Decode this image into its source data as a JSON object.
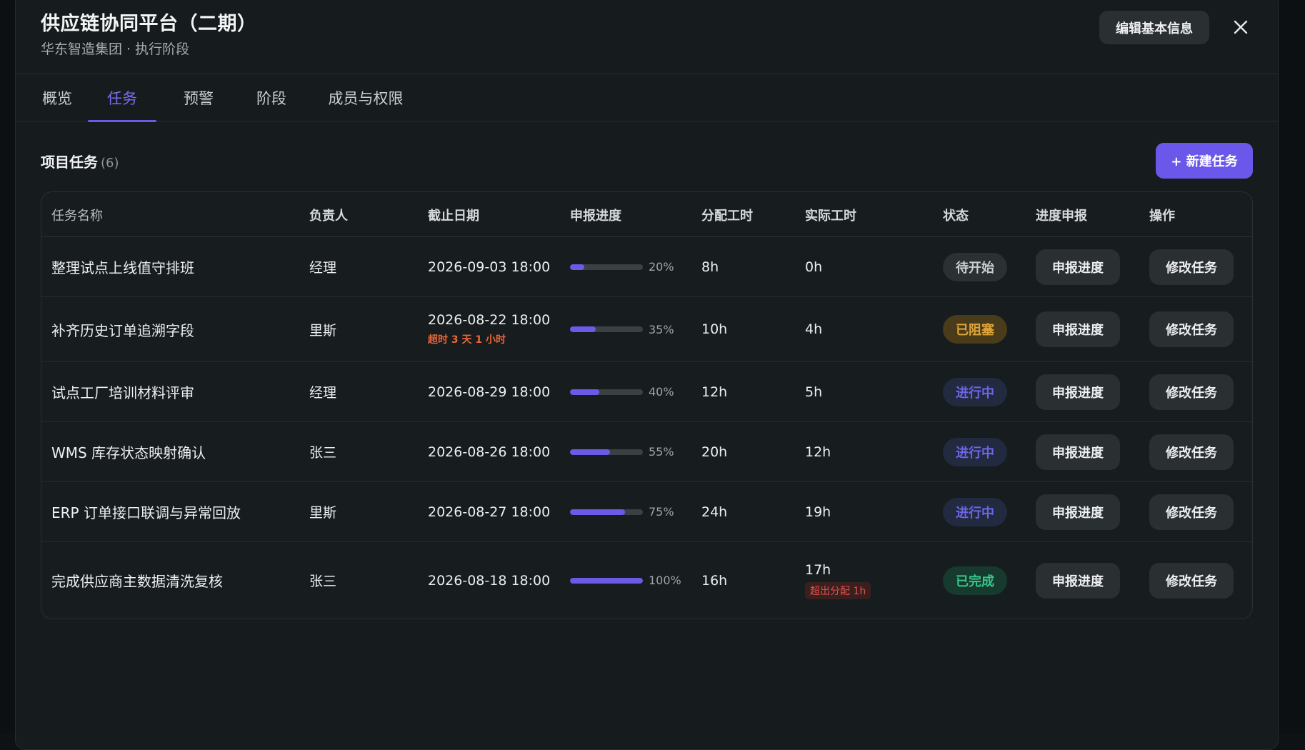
{
  "header": {
    "title": "供应链协同平台（二期）",
    "subtitle": "华东智造集团 · 执行阶段",
    "edit_label": "编辑基本信息",
    "close_icon": "close-icon"
  },
  "tabs": [
    {
      "label": "概览",
      "active": false
    },
    {
      "label": "任务",
      "active": true
    },
    {
      "label": "预警",
      "active": false
    },
    {
      "label": "阶段",
      "active": false
    },
    {
      "label": "成员与权限",
      "active": false
    }
  ],
  "section": {
    "title": "项目任务",
    "count": "(6)",
    "new_label": "+ 新建任务"
  },
  "table": {
    "columns": [
      "任务名称",
      "负责人",
      "截止日期",
      "申报进度",
      "分配工时",
      "实际工时",
      "状态",
      "进度申报",
      "操作"
    ],
    "rows": [
      {
        "name": "整理试点上线值守排班",
        "owner": "经理",
        "deadline": "2026-09-03 18:00",
        "deadline_note": "",
        "progress": 20,
        "progress_label": "20%",
        "allocated": "8h",
        "actual": "0h",
        "actual_note": "",
        "status": "待开始",
        "status_type": "pending",
        "report": "申报进度",
        "edit": "修改任务"
      },
      {
        "name": "补齐历史订单追溯字段",
        "owner": "里斯",
        "deadline": "2026-08-22 18:00",
        "deadline_note": "超时 3 天 1 小时",
        "progress": 35,
        "progress_label": "35%",
        "allocated": "10h",
        "actual": "4h",
        "actual_note": "",
        "status": "已阻塞",
        "status_type": "blocked",
        "report": "申报进度",
        "edit": "修改任务"
      },
      {
        "name": "试点工厂培训材料评审",
        "owner": "经理",
        "deadline": "2026-08-29 18:00",
        "deadline_note": "",
        "progress": 40,
        "progress_label": "40%",
        "allocated": "12h",
        "actual": "5h",
        "actual_note": "",
        "status": "进行中",
        "status_type": "running",
        "report": "申报进度",
        "edit": "修改任务"
      },
      {
        "name": "WMS 库存状态映射确认",
        "owner": "张三",
        "deadline": "2026-08-26 18:00",
        "deadline_note": "",
        "progress": 55,
        "progress_label": "55%",
        "allocated": "20h",
        "actual": "12h",
        "actual_note": "",
        "status": "进行中",
        "status_type": "running",
        "report": "申报进度",
        "edit": "修改任务"
      },
      {
        "name": "ERP 订单接口联调与异常回放",
        "owner": "里斯",
        "deadline": "2026-08-27 18:00",
        "deadline_note": "",
        "progress": 75,
        "progress_label": "75%",
        "allocated": "24h",
        "actual": "19h",
        "actual_note": "",
        "status": "进行中",
        "status_type": "running",
        "report": "申报进度",
        "edit": "修改任务"
      },
      {
        "name": "完成供应商主数据清洗复核",
        "owner": "张三",
        "deadline": "2026-08-18 18:00",
        "deadline_note": "",
        "progress": 100,
        "progress_label": "100%",
        "allocated": "16h",
        "actual": "17h",
        "actual_note": "超出分配 1h",
        "status": "已完成",
        "status_type": "done",
        "report": "申报进度",
        "edit": "修改任务"
      }
    ]
  },
  "colors": {
    "accent": "#6a5ae8",
    "background": "#161b1d",
    "warning": "#e8663a",
    "success": "#38c48a",
    "blocked": "#e0a53a"
  }
}
